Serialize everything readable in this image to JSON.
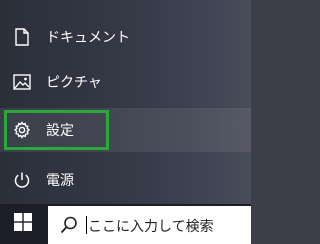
{
  "start_menu": {
    "items": [
      {
        "label": "ドキュメント",
        "icon": "document-icon"
      },
      {
        "label": "ピクチャ",
        "icon": "picture-icon"
      },
      {
        "label": "設定",
        "icon": "gear-icon",
        "highlighted": true
      },
      {
        "label": "電源",
        "icon": "power-icon"
      }
    ],
    "highlight_color": "#2aa83c"
  },
  "taskbar": {
    "start_icon": "windows-logo-icon",
    "search": {
      "icon": "search-icon",
      "placeholder": "ここに入力して検索"
    }
  }
}
